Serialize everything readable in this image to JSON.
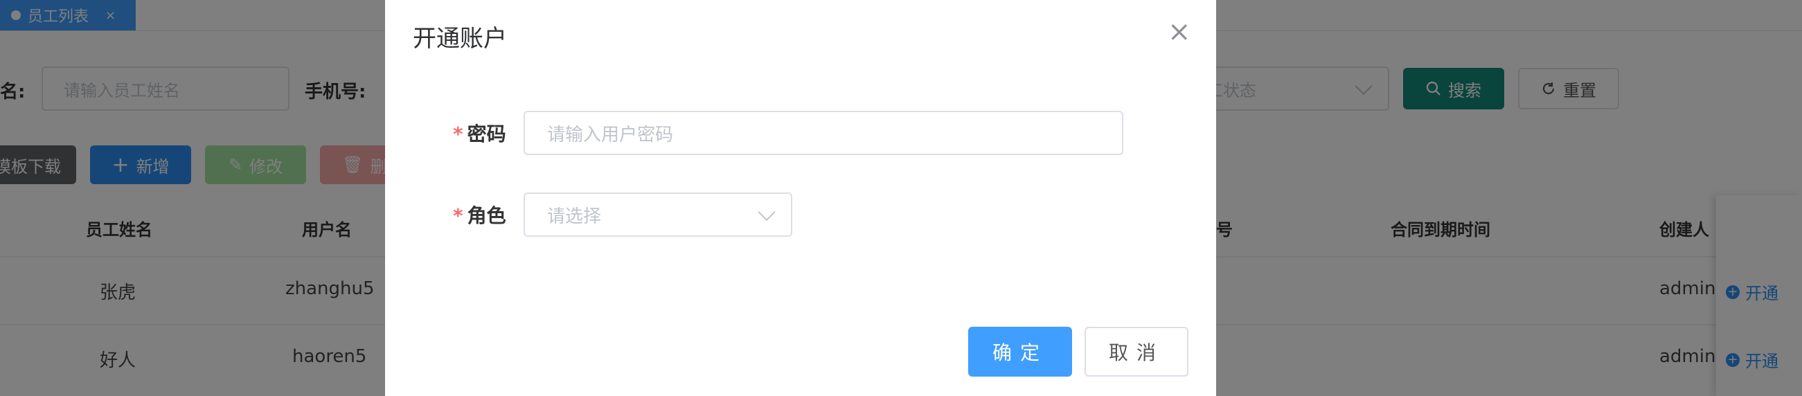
{
  "tags": {
    "active_label": "员工列表",
    "close_glyph": "×"
  },
  "search": {
    "name_label": "名:",
    "name_placeholder": "请输入员工姓名",
    "phone_label": "手机号:",
    "status_placeholder": "工状态",
    "search_label": "搜索",
    "reset_label": "重置"
  },
  "toolbar": {
    "template_label": "模板下载",
    "add_label": "新增",
    "edit_label": "修改",
    "delete_label": "删"
  },
  "table": {
    "headers": [
      "员工姓名",
      "用户名",
      "号",
      "合同到期时间",
      "创建人"
    ],
    "rows": [
      {
        "name": "张虎",
        "username": "zhanghu5",
        "creator": "admin",
        "action": "开通"
      },
      {
        "name": "好人",
        "username": "haoren5",
        "creator": "admin",
        "action": "开通"
      }
    ]
  },
  "dialog": {
    "title": "开通账户",
    "close_glyph": "×",
    "password_label": "密码",
    "password_placeholder": "请输入用户密码",
    "role_label": "角色",
    "role_placeholder": "请选择",
    "required_mark": "*",
    "ok_label": "确定",
    "cancel_label": "取消"
  },
  "colors": {
    "primary": "#409eff",
    "search_button": "#13897a",
    "required": "#f56c6c",
    "overlay": "rgba(0,0,0,0.5)"
  },
  "icons": [
    "close-icon",
    "search-icon",
    "refresh-icon",
    "plus-icon",
    "edit-icon",
    "trash-icon",
    "plus-circle-icon",
    "chevron-down-icon"
  ]
}
